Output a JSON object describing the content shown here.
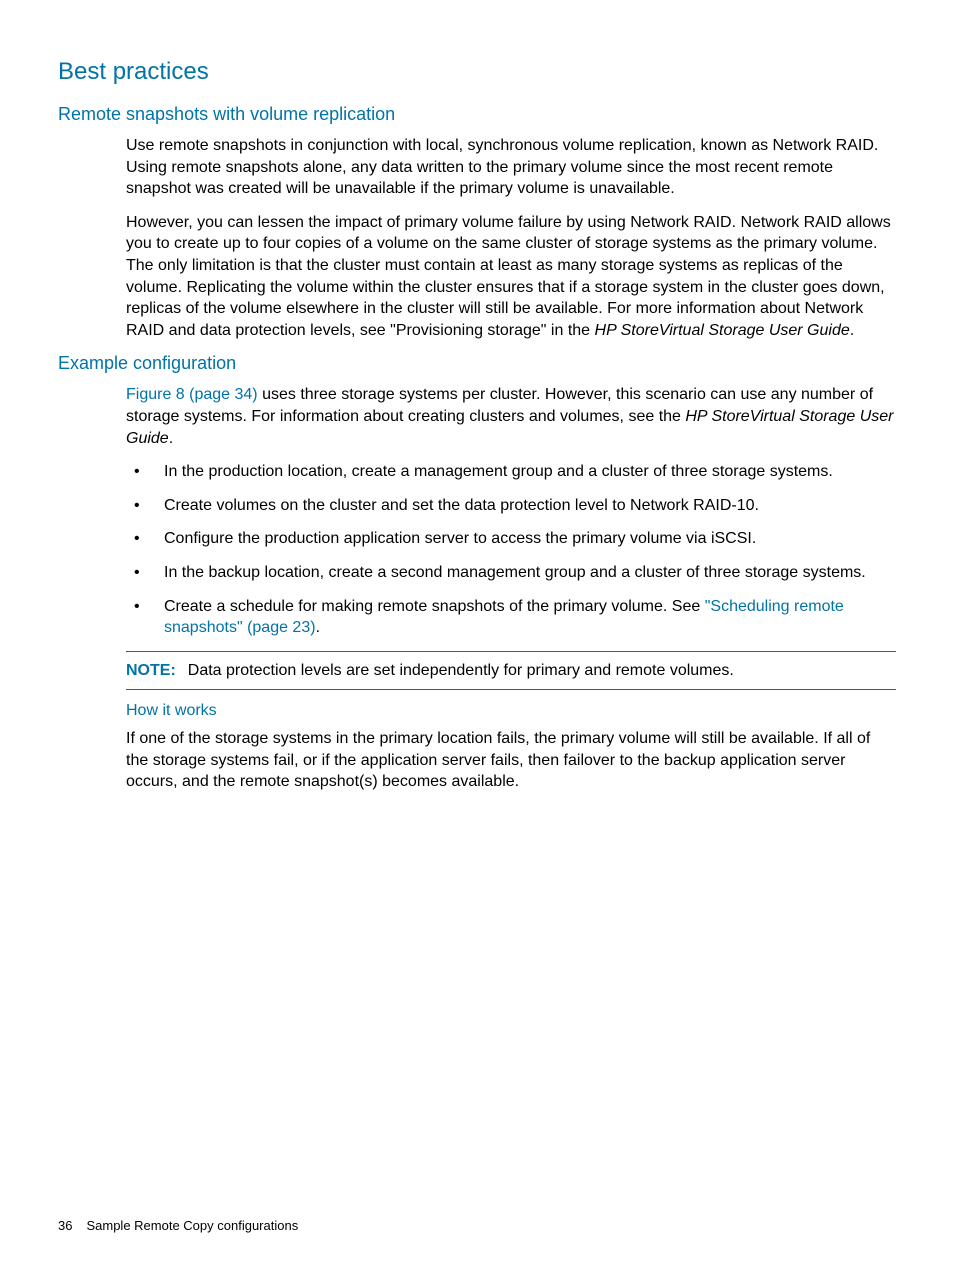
{
  "headings": {
    "h1": "Best practices",
    "h2a": "Remote snapshots with volume replication",
    "h2b": "Example configuration",
    "h3": "How it works"
  },
  "paragraphs": {
    "p1": "Use remote snapshots in conjunction with local, synchronous volume replication, known as Network RAID. Using remote snapshots alone, any data written to the primary volume since the most recent remote snapshot was created will be unavailable if the primary volume is unavailable.",
    "p2_a": "However, you can lessen the impact of primary volume failure by using Network RAID. Network RAID allows you to create up to four copies of a volume on the same cluster of storage systems as the primary volume. The only limitation is that the cluster must contain at least as many storage systems as replicas of the volume. Replicating the volume within the cluster ensures that if a storage system in the cluster goes down, replicas of the volume elsewhere in the cluster will still be available. For more information about Network RAID and data protection levels, see \"Provisioning storage\" in the ",
    "p2_italic": "HP StoreVirtual Storage User Guide",
    "p2_end": ".",
    "p3_link": "Figure 8 (page 34)",
    "p3_a": " uses three storage systems per cluster. However, this scenario can use any number of storage systems. For information about creating clusters and volumes, see the ",
    "p3_italic": "HP StoreVirtual Storage User Guide",
    "p3_end": ".",
    "p4": "If one of the storage systems in the primary location fails, the primary volume will still be available. If all of the storage systems fail, or if the application server fails, then failover to the backup application server occurs, and the remote snapshot(s) becomes available."
  },
  "bullets": {
    "b1": "In the production location, create a management group and a cluster of three storage systems.",
    "b2": "Create volumes on the cluster and set the data protection level to Network RAID-10.",
    "b3": "Configure the production application server to access the primary volume via iSCSI.",
    "b4": "In the backup location, create a second management group and a cluster of three storage systems.",
    "b5_a": "Create a schedule for making remote snapshots of the primary volume. See ",
    "b5_link": "\"Scheduling remote snapshots\" (page 23)",
    "b5_end": "."
  },
  "note": {
    "label": "NOTE:",
    "text": "Data protection levels are set independently for primary and remote volumes."
  },
  "footer": {
    "pagenum": "36",
    "section": "Sample Remote Copy configurations"
  }
}
